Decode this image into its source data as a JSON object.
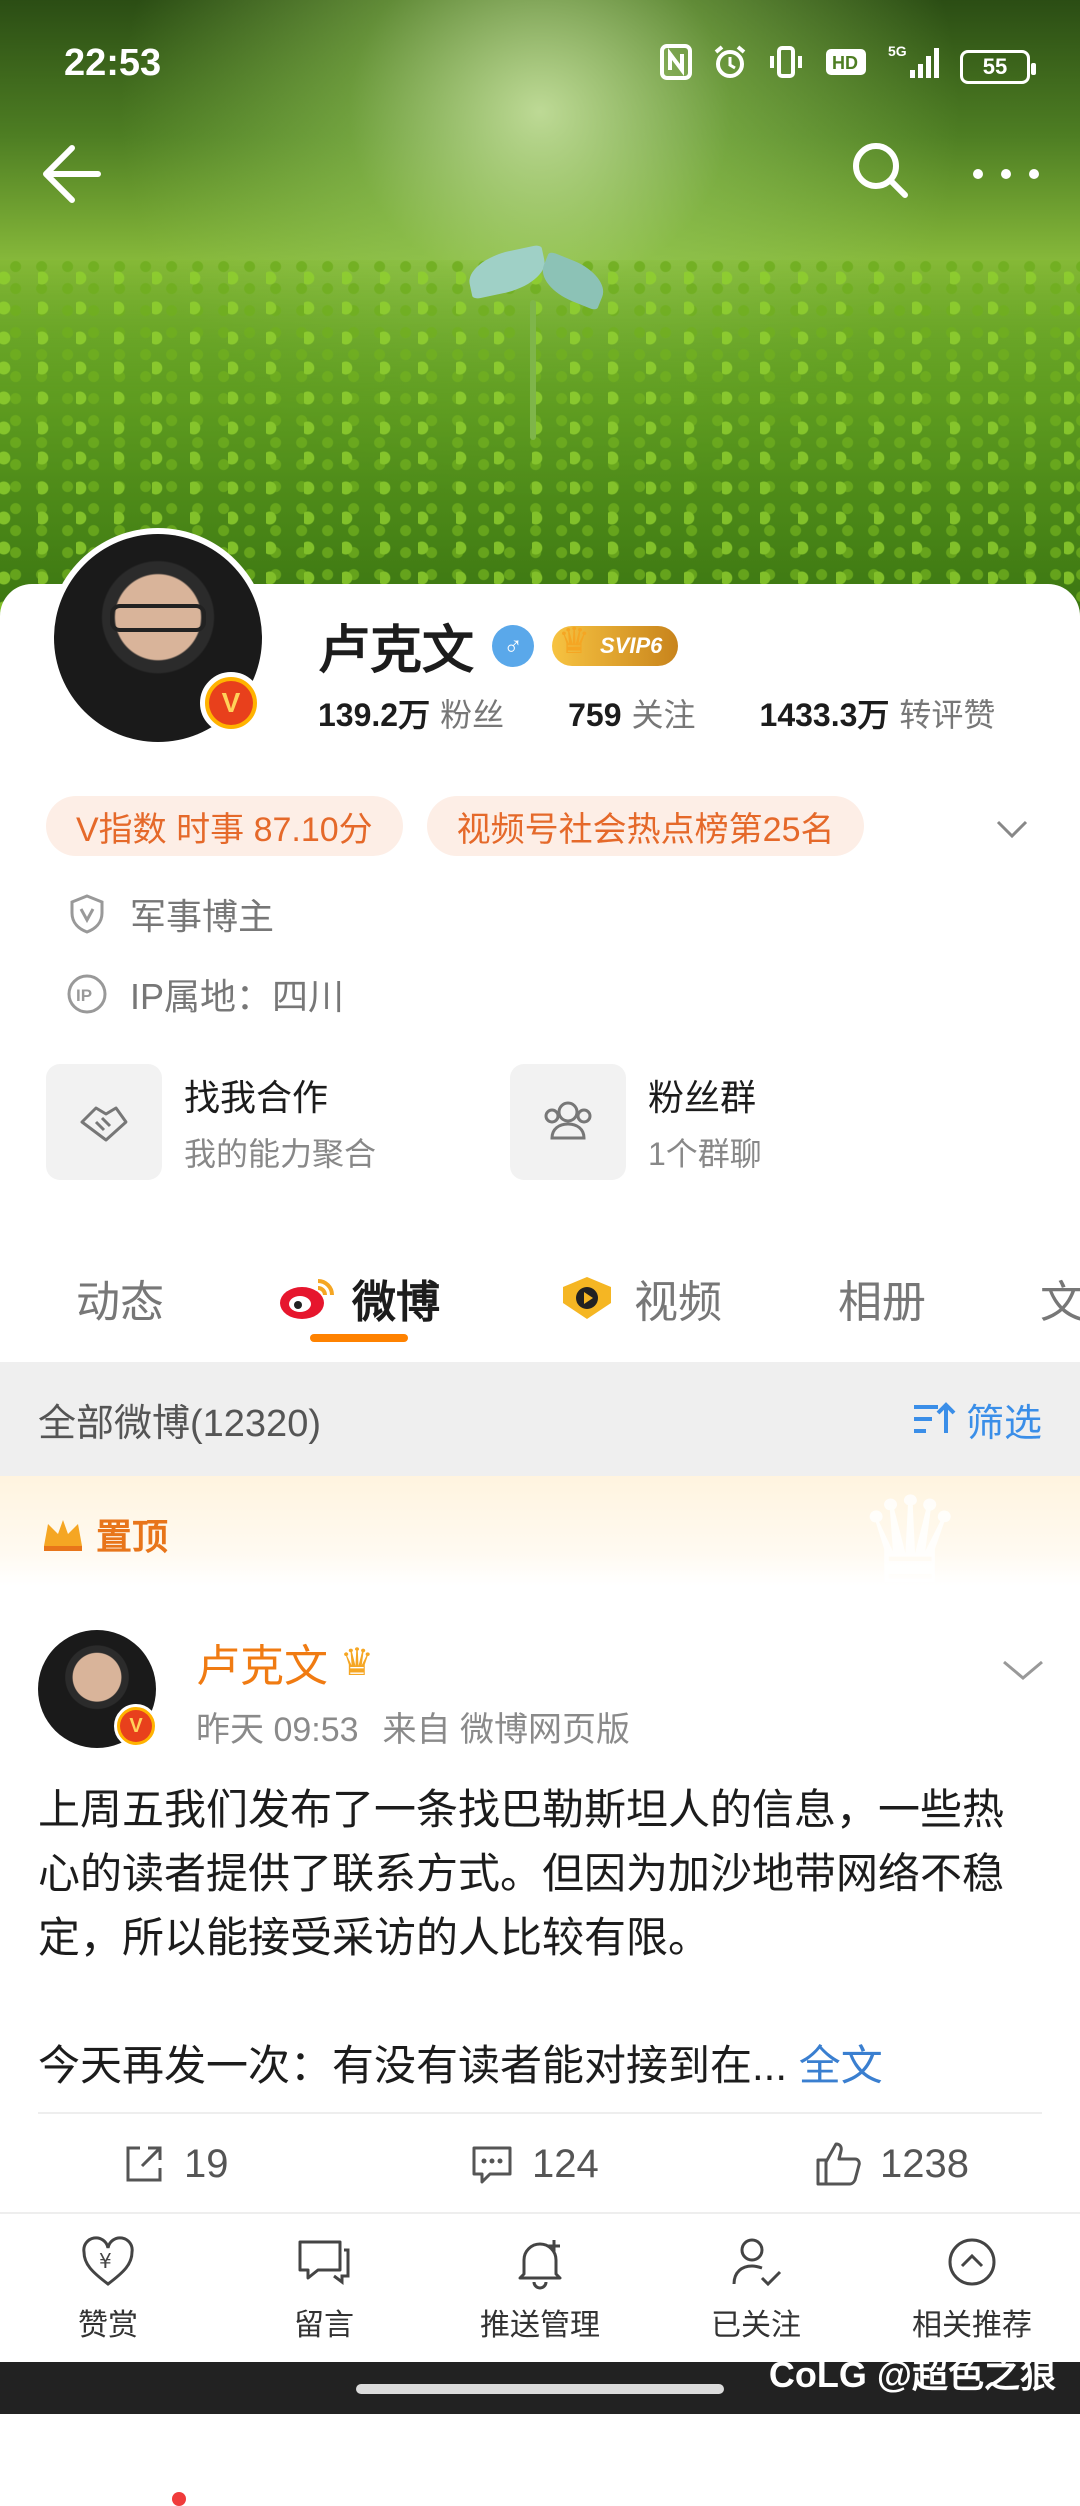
{
  "status_bar": {
    "time": "22:53",
    "battery": "55",
    "network": "5G",
    "icons": [
      "nfc-icon",
      "alarm-icon",
      "vibrate-icon",
      "hd-icon",
      "signal-icon",
      "battery-icon"
    ]
  },
  "topnav": {
    "icons": [
      "back-arrow-icon",
      "search-icon",
      "more-dots-icon"
    ]
  },
  "profile": {
    "name": "卢克文",
    "vip_badge": "SVIP6",
    "verified": "V",
    "stats": [
      {
        "num": "139.2万",
        "label": "粉丝"
      },
      {
        "num": "759",
        "label": "关注"
      },
      {
        "num": "1433.3万",
        "label": "转评赞"
      }
    ],
    "pills": [
      "V指数 时事 87.10分",
      "视频号社会热点榜第25名"
    ],
    "info": [
      "军事博主",
      "IP属地：四川"
    ],
    "tiles": [
      {
        "title": "找我合作",
        "subtitle": "我的能力聚合"
      },
      {
        "title": "粉丝群",
        "subtitle": "1个群聊"
      }
    ]
  },
  "tabs": [
    "动态",
    "微博",
    "视频",
    "相册",
    "文"
  ],
  "filter": {
    "count_label": "全部微博(12320)",
    "filter_label": "筛选"
  },
  "pinned": {
    "label": "置顶"
  },
  "post": {
    "author": "卢克文",
    "time": "昨天 09:53",
    "source": "来自 微博网页版",
    "text_p1": "上周五我们发布了一条找巴勒斯坦人的信息，一些热心的读者提供了联系方式。但因为加沙地带网络不稳定，所以能接受采访的人比较有限。",
    "text_p2": "今天再发一次：有没有读者能对接到在...",
    "more": "全文",
    "reposts": "19",
    "comments": "124",
    "likes": "1238"
  },
  "bottom_bar": [
    {
      "label": "赞赏",
      "icon": "heart-yuan-icon"
    },
    {
      "label": "留言",
      "icon": "message-icon"
    },
    {
      "label": "推送管理",
      "icon": "bell-plus-icon"
    },
    {
      "label": "已关注",
      "icon": "user-check-icon"
    },
    {
      "label": "相关推荐",
      "icon": "chevron-up-circle-icon"
    }
  ],
  "watermark": "CoLG @超色之狼",
  "colors": {
    "accent_orange": "#ff8200",
    "link_blue": "#3a8ee8",
    "pill_text": "#e5692a",
    "post_name": "#f07b12"
  }
}
